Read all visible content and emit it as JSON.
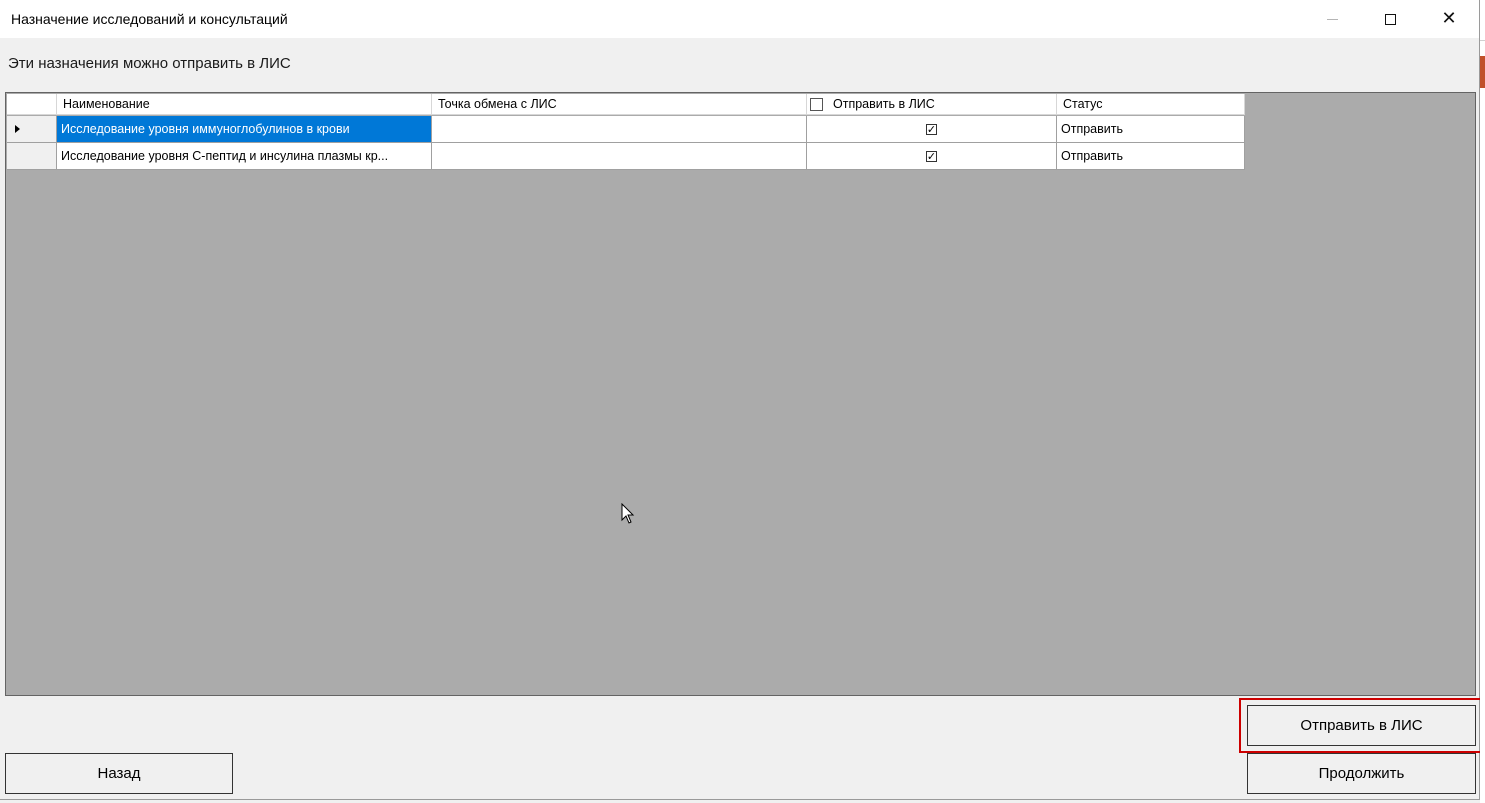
{
  "window": {
    "title": "Назначение исследований и консультаций",
    "subtitle": "Эти назначения можно отправить в ЛИС"
  },
  "grid": {
    "columns": [
      "Наименование",
      "Точка обмена с ЛИС",
      "Отправить в ЛИС",
      "Статус"
    ],
    "rows": [
      {
        "name": "Исследование уровня иммуноглобулинов в крови",
        "exchange_point": "",
        "send_checked": "✓",
        "status": "Отправить"
      },
      {
        "name": "Исследование уровня С-пептид и инсулина плазмы кр...",
        "exchange_point": "",
        "send_checked": "✓",
        "status": "Отправить"
      }
    ],
    "header_checkbox": ""
  },
  "buttons": {
    "send": "Отправить в ЛИС",
    "continue": "Продолжить",
    "back": "Назад"
  },
  "colors": {
    "selection": "#0078d7",
    "highlight": "#cc0000",
    "grid_bg": "#ababab"
  }
}
